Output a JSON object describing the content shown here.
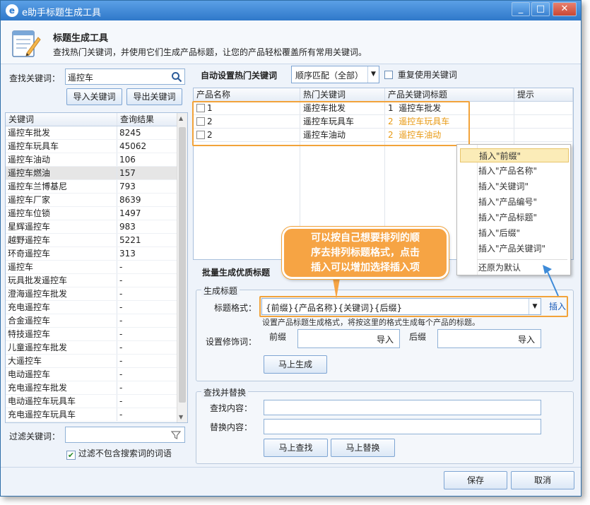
{
  "window": {
    "title": "e助手标题生成工具",
    "minimize": "_",
    "maximize": "□",
    "close": "✕"
  },
  "header": {
    "title": "标题生成工具",
    "desc": "查找热门关键词，并使用它们生成产品标题，让您的产品轻松覆盖所有常用关键词。"
  },
  "search": {
    "label": "查找关键词：",
    "value": "遥控车",
    "import_label": "导入关键词",
    "export_label": "导出关键词"
  },
  "keywords": {
    "headers": [
      "关键词",
      "查询结果"
    ],
    "rows": [
      [
        "遥控车批发",
        "8245"
      ],
      [
        "遥控车玩具车",
        "45062"
      ],
      [
        "遥控车油动",
        "106"
      ],
      [
        "遥控车燃油",
        "157"
      ],
      [
        "遥控车兰博基尼",
        "793"
      ],
      [
        "遥控车厂家",
        "8639"
      ],
      [
        "遥控车位锁",
        "1497"
      ],
      [
        "星辉遥控车",
        "983"
      ],
      [
        "越野遥控车",
        "5221"
      ],
      [
        "环奇遥控车",
        "313"
      ],
      [
        "遥控车",
        "-"
      ],
      [
        "玩具批发遥控车",
        "-"
      ],
      [
        "澄海遥控车批发",
        "-"
      ],
      [
        "充电遥控车",
        "-"
      ],
      [
        "合金遥控车",
        "-"
      ],
      [
        "特技遥控车",
        "-"
      ],
      [
        "儿童遥控车批发",
        "-"
      ],
      [
        "大遥控车",
        "-"
      ],
      [
        "电动遥控车",
        "-"
      ],
      [
        "充电遥控车批发",
        "-"
      ],
      [
        "电动遥控车玩具车",
        "-"
      ],
      [
        "充电遥控车玩具车",
        "-"
      ]
    ],
    "selected_index": 3
  },
  "filter": {
    "label": "过滤关键词：",
    "value": "",
    "checkbox_label": "过滤不包含搜索词的词语",
    "checked": true
  },
  "auto": {
    "label": "自动设置热门关键词",
    "match_value": "顺序匹配（全部）",
    "reuse_label": "重复使用关键词"
  },
  "products": {
    "headers": [
      "产品名称",
      "热门关键词",
      "产品关键词标题",
      "提示"
    ],
    "rows": [
      {
        "name": "1",
        "keyword": "遥控车批发",
        "title": "1  遥控车批发",
        "hint": "",
        "highlight": false
      },
      {
        "name": "2",
        "keyword": "遥控车玩具车",
        "title": "2  遥控车玩具车",
        "hint": "",
        "highlight": true
      },
      {
        "name": "2",
        "keyword": "遥控车油动",
        "title": "2  遥控车油动",
        "hint": "",
        "highlight": true
      }
    ]
  },
  "context_menu": {
    "items": [
      "插入\"前缀\"",
      "插入\"产品名称\"",
      "插入\"关键词\"",
      "插入\"产品编号\"",
      "插入\"产品标题\"",
      "插入\"后缀\"",
      "插入\"产品关键词\""
    ],
    "reset": "还原为默认",
    "highlighted_index": 0
  },
  "callout": {
    "lines": [
      "可以按自己想要排列的顺",
      "序去排列标题格式，点击",
      "插入可以增加选择插入项"
    ]
  },
  "batch": {
    "label": "批量生成优质标题"
  },
  "generate": {
    "group_title": "生成标题",
    "format_label": "标题格式：",
    "format_value": "{前缀}{产品名称}{关键词}{后缀}",
    "insert_label": "插入",
    "hint": "设置产品标题生成格式，将按这里的格式生成每个产品的标题。",
    "modifier_label": "设置修饰词：",
    "prefix_label": "前缀",
    "suffix_label": "后缀",
    "import_label": "导入",
    "generate_button": "马上生成"
  },
  "replace": {
    "group_title": "查找并替换",
    "find_label": "查找内容：",
    "replace_label": "替换内容：",
    "find_button": "马上查找",
    "replace_button": "马上替换"
  },
  "footer": {
    "save": "保存",
    "cancel": "取消"
  },
  "colors": {
    "accent": "#2f78c9",
    "highlight": "#f2a33a",
    "callout": "#f6a444"
  }
}
